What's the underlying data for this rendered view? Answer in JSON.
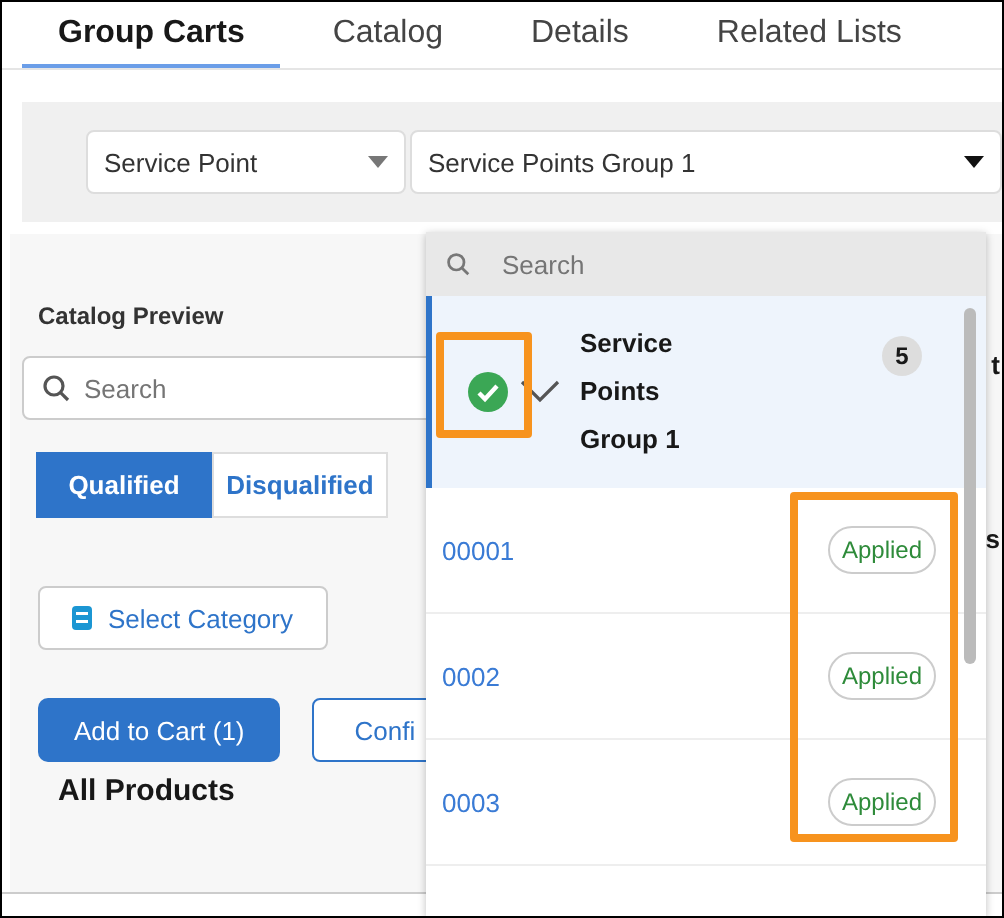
{
  "tabs": [
    {
      "label": "Group Carts",
      "selected": true
    },
    {
      "label": "Catalog",
      "selected": false
    },
    {
      "label": "Details",
      "selected": false
    },
    {
      "label": "Related Lists",
      "selected": false
    }
  ],
  "filters": [
    {
      "value": "Service Point"
    },
    {
      "value": "Service Points Group 1"
    }
  ],
  "catalog_preview": {
    "title": "Catalog Preview",
    "search": {
      "placeholder": "Search"
    },
    "toggle": [
      {
        "label": "Qualified",
        "selected": true
      },
      {
        "label": "Disqualified",
        "selected": false
      }
    ],
    "select_category": "Select Category",
    "add_to_cart": "Add to Cart (1)",
    "configure": "Confi",
    "heading": "All Products",
    "side_texts": [
      "t",
      "s"
    ]
  },
  "dropdown": {
    "search": {
      "placeholder": "Search"
    },
    "group": {
      "label": "Service Points Group 1",
      "count": "5",
      "checked": true,
      "expanded": true,
      "selected": true
    },
    "items": [
      {
        "label": "00001",
        "status": "Applied"
      },
      {
        "label": "0002",
        "status": "Applied"
      },
      {
        "label": "0003",
        "status": "Applied"
      }
    ]
  }
}
